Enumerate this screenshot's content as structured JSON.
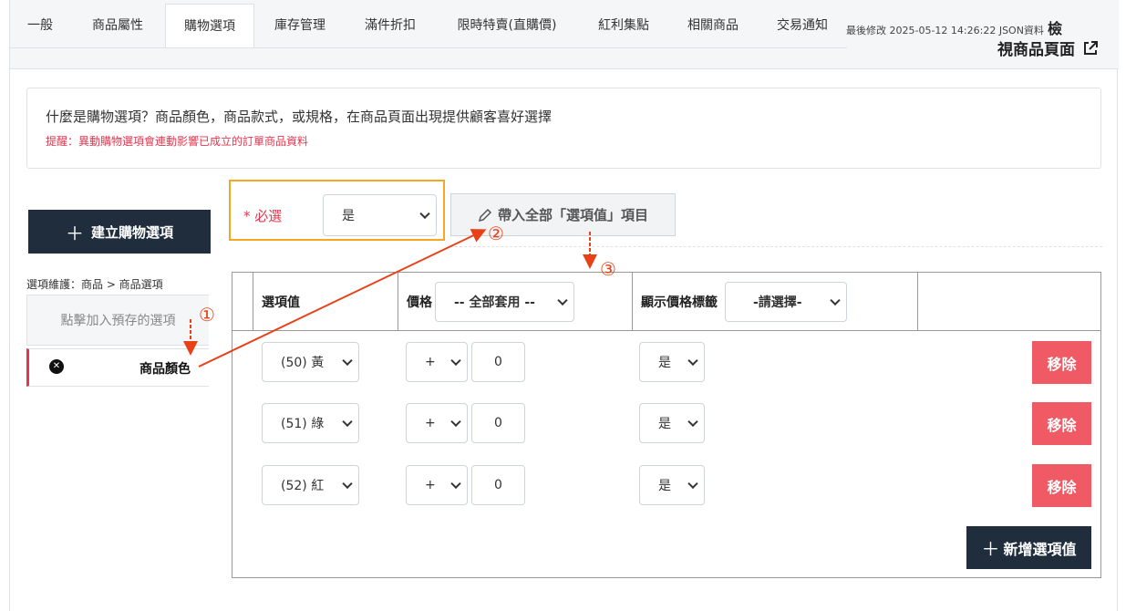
{
  "tabs": [
    "一般",
    "商品屬性",
    "購物選項",
    "庫存管理",
    "滿件折扣",
    "限時特賣(直購價)",
    "紅利集點",
    "相關商品",
    "交易通知"
  ],
  "active_tab": "購物選項",
  "meta": {
    "last_modified": "最後修改 2025-05-12 14:26:22 JSON資料",
    "view_prefix": "檢",
    "view_page": "視商品頁面"
  },
  "info": {
    "question": "什麼是購物選項？商品顏色，商品款式，或規格，在商品頁面出現提供顧客喜好選擇",
    "warning": "提醒：異動購物選項會連動影響已成立的訂單商品資料"
  },
  "left": {
    "create_button": "建立購物選項",
    "breadcrumb": "選項維護：商品 > 商品選項",
    "preset": "點擊加入預存的選項",
    "option_item": "商品顏色"
  },
  "required": {
    "label": "* 必選",
    "value": "是"
  },
  "import_button": "帶入全部「選項值」項目",
  "table": {
    "col_value": "選項值",
    "col_price": "價格",
    "price_all": "-- 全部套用 --",
    "col_tag": "顯示價格標籤",
    "tag_select": "-請選擇-",
    "rows": [
      {
        "value": "(50) 黃",
        "sign": "+",
        "price": "0",
        "tag": "是",
        "remove": "移除"
      },
      {
        "value": "(51) 綠",
        "sign": "+",
        "price": "0",
        "tag": "是",
        "remove": "移除"
      },
      {
        "value": "(52) 紅",
        "sign": "+",
        "price": "0",
        "tag": "是",
        "remove": "移除"
      }
    ],
    "add_button": "新增選項值"
  },
  "annotations": [
    "①",
    "②",
    "③"
  ],
  "colors": {
    "dark": "#1f2d3d",
    "danger": "#f05a64",
    "highlight": "#f5a623",
    "arrow": "#e84118"
  }
}
